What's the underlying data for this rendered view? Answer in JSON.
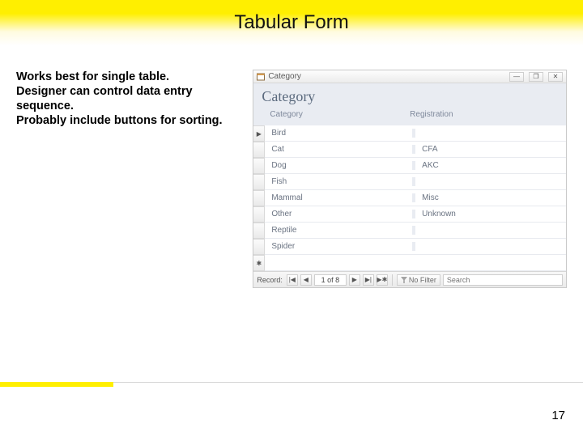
{
  "slide": {
    "title": "Tabular Form",
    "bullets": [
      "Works best for single table.",
      "Designer can control data entry sequence.",
      "Probably include buttons for sorting."
    ],
    "page_number": "17"
  },
  "window": {
    "tab_label": "Category",
    "buttons": {
      "minimize": "—",
      "restore": "❐",
      "close": "✕"
    },
    "form_title": "Category",
    "columns": {
      "c1": "Category",
      "c2": "Registration"
    },
    "rows": [
      {
        "category": "Bird",
        "registration": ""
      },
      {
        "category": "Cat",
        "registration": "CFA"
      },
      {
        "category": "Dog",
        "registration": "AKC"
      },
      {
        "category": "Fish",
        "registration": ""
      },
      {
        "category": "Mammal",
        "registration": "Misc"
      },
      {
        "category": "Other",
        "registration": "Unknown"
      },
      {
        "category": "Reptile",
        "registration": ""
      },
      {
        "category": "Spider",
        "registration": ""
      }
    ],
    "selectors": {
      "current": "▶",
      "new": "✱"
    },
    "nav": {
      "label": "Record:",
      "first": "|◀",
      "prev": "◀",
      "counter": "1 of 8",
      "next": "▶",
      "last": "▶|",
      "new": "▶✱",
      "filter": "No Filter",
      "search_placeholder": "Search"
    }
  }
}
